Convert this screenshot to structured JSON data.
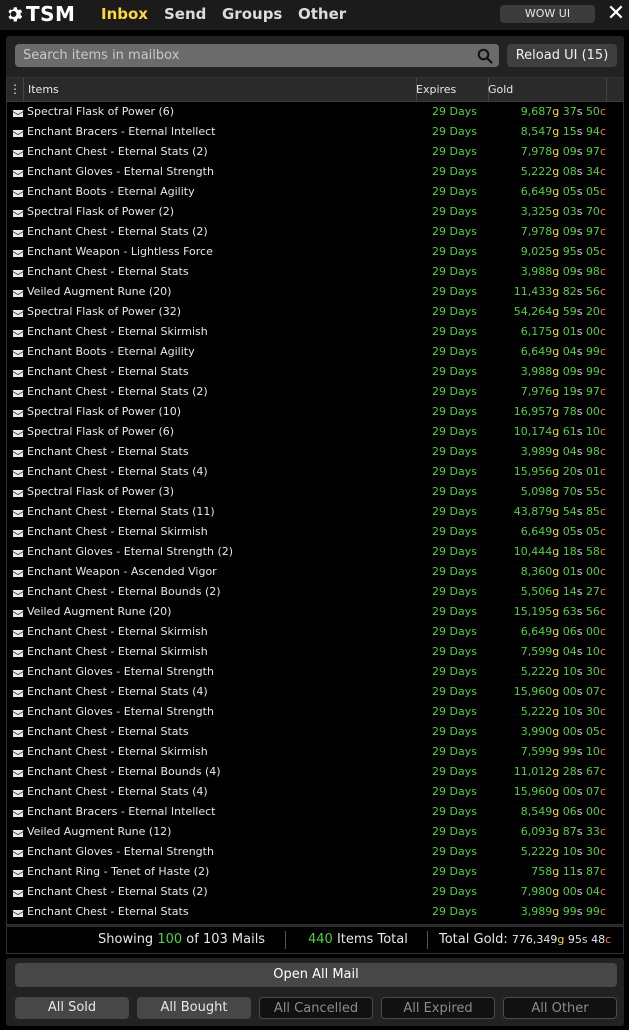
{
  "titlebar": {
    "logo_text": "TSM",
    "tabs": [
      {
        "label": "Inbox",
        "active": true
      },
      {
        "label": "Send",
        "active": false
      },
      {
        "label": "Groups",
        "active": false
      },
      {
        "label": "Other",
        "active": false
      }
    ],
    "wow_ui_label": "WOW UI",
    "close_icon": "close-icon"
  },
  "search": {
    "placeholder": "Search items in mailbox",
    "value": ""
  },
  "reload_label": "Reload UI (15)",
  "table": {
    "columns": {
      "menu": "⋮",
      "items": "Items",
      "expires": "Expires",
      "gold": "Gold"
    },
    "rows": [
      {
        "item": "Spectral Flask of Power (6)",
        "expires": "29 Days",
        "gold": "9,687",
        "silver": "37",
        "copper": "50"
      },
      {
        "item": "Enchant Bracers - Eternal Intellect",
        "expires": "29 Days",
        "gold": "8,547",
        "silver": "15",
        "copper": "94"
      },
      {
        "item": "Enchant Chest - Eternal Stats (2)",
        "expires": "29 Days",
        "gold": "7,978",
        "silver": "09",
        "copper": "97"
      },
      {
        "item": "Enchant Gloves - Eternal Strength",
        "expires": "29 Days",
        "gold": "5,222",
        "silver": "08",
        "copper": "34"
      },
      {
        "item": "Enchant Boots - Eternal Agility",
        "expires": "29 Days",
        "gold": "6,649",
        "silver": "05",
        "copper": "05"
      },
      {
        "item": "Spectral Flask of Power (2)",
        "expires": "29 Days",
        "gold": "3,325",
        "silver": "03",
        "copper": "70"
      },
      {
        "item": "Enchant Chest - Eternal Stats (2)",
        "expires": "29 Days",
        "gold": "7,978",
        "silver": "09",
        "copper": "97"
      },
      {
        "item": "Enchant Weapon - Lightless Force",
        "expires": "29 Days",
        "gold": "9,025",
        "silver": "95",
        "copper": "05"
      },
      {
        "item": "Enchant Chest - Eternal Stats",
        "expires": "29 Days",
        "gold": "3,988",
        "silver": "09",
        "copper": "98"
      },
      {
        "item": "Veiled Augment Rune (20)",
        "expires": "29 Days",
        "gold": "11,433",
        "silver": "82",
        "copper": "56"
      },
      {
        "item": "Spectral Flask of Power (32)",
        "expires": "29 Days",
        "gold": "54,264",
        "silver": "59",
        "copper": "20"
      },
      {
        "item": "Enchant Chest - Eternal Skirmish",
        "expires": "29 Days",
        "gold": "6,175",
        "silver": "01",
        "copper": "00"
      },
      {
        "item": "Enchant Boots - Eternal Agility",
        "expires": "29 Days",
        "gold": "6,649",
        "silver": "04",
        "copper": "99"
      },
      {
        "item": "Enchant Chest - Eternal Stats",
        "expires": "29 Days",
        "gold": "3,988",
        "silver": "09",
        "copper": "99"
      },
      {
        "item": "Enchant Chest - Eternal Stats (2)",
        "expires": "29 Days",
        "gold": "7,976",
        "silver": "19",
        "copper": "97"
      },
      {
        "item": "Spectral Flask of Power (10)",
        "expires": "29 Days",
        "gold": "16,957",
        "silver": "78",
        "copper": "00"
      },
      {
        "item": "Spectral Flask of Power (6)",
        "expires": "29 Days",
        "gold": "10,174",
        "silver": "61",
        "copper": "10"
      },
      {
        "item": "Enchant Chest - Eternal Stats",
        "expires": "29 Days",
        "gold": "3,989",
        "silver": "04",
        "copper": "98"
      },
      {
        "item": "Enchant Chest - Eternal Stats (4)",
        "expires": "29 Days",
        "gold": "15,956",
        "silver": "20",
        "copper": "01"
      },
      {
        "item": "Spectral Flask of Power (3)",
        "expires": "29 Days",
        "gold": "5,098",
        "silver": "70",
        "copper": "55"
      },
      {
        "item": "Enchant Chest - Eternal Stats (11)",
        "expires": "29 Days",
        "gold": "43,879",
        "silver": "54",
        "copper": "85"
      },
      {
        "item": "Enchant Chest - Eternal Skirmish",
        "expires": "29 Days",
        "gold": "6,649",
        "silver": "05",
        "copper": "05"
      },
      {
        "item": "Enchant Gloves - Eternal Strength (2)",
        "expires": "29 Days",
        "gold": "10,444",
        "silver": "18",
        "copper": "58"
      },
      {
        "item": "Enchant Weapon - Ascended Vigor",
        "expires": "29 Days",
        "gold": "8,360",
        "silver": "01",
        "copper": "00"
      },
      {
        "item": "Enchant Chest - Eternal Bounds (2)",
        "expires": "29 Days",
        "gold": "5,506",
        "silver": "14",
        "copper": "27"
      },
      {
        "item": "Veiled Augment Rune (20)",
        "expires": "29 Days",
        "gold": "15,195",
        "silver": "63",
        "copper": "56"
      },
      {
        "item": "Enchant Chest - Eternal Skirmish",
        "expires": "29 Days",
        "gold": "6,649",
        "silver": "06",
        "copper": "00"
      },
      {
        "item": "Enchant Chest - Eternal Skirmish",
        "expires": "29 Days",
        "gold": "7,599",
        "silver": "04",
        "copper": "10"
      },
      {
        "item": "Enchant Gloves - Eternal Strength",
        "expires": "29 Days",
        "gold": "5,222",
        "silver": "10",
        "copper": "30"
      },
      {
        "item": "Enchant Chest - Eternal Stats (4)",
        "expires": "29 Days",
        "gold": "15,960",
        "silver": "00",
        "copper": "07"
      },
      {
        "item": "Enchant Gloves - Eternal Strength",
        "expires": "29 Days",
        "gold": "5,222",
        "silver": "10",
        "copper": "30"
      },
      {
        "item": "Enchant Chest - Eternal Stats",
        "expires": "29 Days",
        "gold": "3,990",
        "silver": "00",
        "copper": "05"
      },
      {
        "item": "Enchant Chest - Eternal Skirmish",
        "expires": "29 Days",
        "gold": "7,599",
        "silver": "99",
        "copper": "10"
      },
      {
        "item": "Enchant Chest - Eternal Bounds (4)",
        "expires": "29 Days",
        "gold": "11,012",
        "silver": "28",
        "copper": "67"
      },
      {
        "item": "Enchant Chest - Eternal Stats (4)",
        "expires": "29 Days",
        "gold": "15,960",
        "silver": "00",
        "copper": "07"
      },
      {
        "item": "Enchant Bracers - Eternal Intellect",
        "expires": "29 Days",
        "gold": "8,549",
        "silver": "06",
        "copper": "00"
      },
      {
        "item": "Veiled Augment Rune (12)",
        "expires": "29 Days",
        "gold": "6,093",
        "silver": "87",
        "copper": "33"
      },
      {
        "item": "Enchant Gloves - Eternal Strength",
        "expires": "29 Days",
        "gold": "5,222",
        "silver": "10",
        "copper": "30"
      },
      {
        "item": "Enchant Ring - Tenet of Haste (2)",
        "expires": "29 Days",
        "gold": "758",
        "silver": "11",
        "copper": "87"
      },
      {
        "item": "Enchant Chest - Eternal Stats (2)",
        "expires": "29 Days",
        "gold": "7,980",
        "silver": "00",
        "copper": "04"
      },
      {
        "item": "Enchant Chest - Eternal Stats",
        "expires": "29 Days",
        "gold": "3,989",
        "silver": "99",
        "copper": "99"
      }
    ]
  },
  "currency_units": {
    "gold": "g",
    "silver": "s",
    "copper": "c"
  },
  "footer": {
    "showing_prefix": "Showing",
    "showing_count": "100",
    "showing_suffix": "of 103 Mails",
    "items_count": "440",
    "items_label": "Items Total",
    "total_label": "Total Gold:",
    "total_gold": "776,349",
    "total_silver": "95",
    "total_copper": "48"
  },
  "open_all_label": "Open All Mail",
  "filters": [
    {
      "label": "All Sold",
      "enabled": true
    },
    {
      "label": "All Bought",
      "enabled": true
    },
    {
      "label": "All Cancelled",
      "enabled": false
    },
    {
      "label": "All Expired",
      "enabled": false
    },
    {
      "label": "All Other",
      "enabled": false
    }
  ],
  "colors": {
    "accent_yellow": "#ffd839",
    "expires_green": "#4fd13a",
    "copper": "#e87e3a",
    "silver": "#cfcfcf"
  }
}
